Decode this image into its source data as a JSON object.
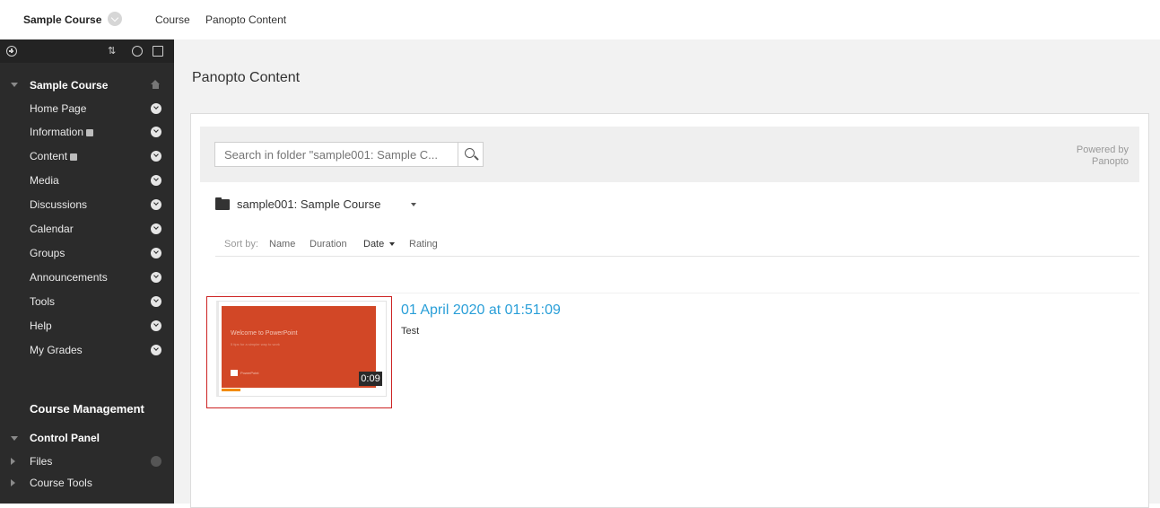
{
  "breadcrumb": {
    "course": "Sample Course",
    "item2": "Course",
    "item3": "Panopto Content"
  },
  "sidebar": {
    "tools": [
      "plus-icon",
      "sort-icon",
      "refresh-icon",
      "folder-icon"
    ],
    "course_section": "Sample Course",
    "items": [
      {
        "label": "Home Page"
      },
      {
        "label": "Information"
      },
      {
        "label": "Content"
      },
      {
        "label": "Media"
      },
      {
        "label": "Discussions"
      },
      {
        "label": "Calendar"
      },
      {
        "label": "Groups"
      },
      {
        "label": "Announcements"
      },
      {
        "label": "Tools"
      },
      {
        "label": "Help"
      },
      {
        "label": "My Grades"
      }
    ],
    "management_title": "Course Management",
    "control_panel": "Control Panel",
    "sub_items": [
      {
        "label": "Files"
      },
      {
        "label": "Course Tools"
      }
    ]
  },
  "main": {
    "title": "Panopto Content",
    "search_placeholder": "Search in folder \"sample001: Sample C...",
    "powered_line1": "Powered by",
    "powered_line2": "Panopto",
    "folder_name": "sample001: Sample Course",
    "sort": {
      "label": "Sort by:",
      "options": [
        "Name",
        "Duration",
        "Date",
        "Rating"
      ],
      "active": "Date"
    },
    "session": {
      "title": "01 April 2020 at 01:51:09",
      "description": "Test",
      "duration": "0:09",
      "progress": 0.12,
      "slide_title": "Welcome to PowerPoint",
      "slide_subtitle": "5 tips for a simpler way to work",
      "slide_brand": "PowerPoint"
    }
  },
  "colors": {
    "sidebar_bg": "#2b2b2b",
    "link_blue": "#2a9fd8",
    "slide_orange": "#d24726",
    "highlight_red": "#cc2222"
  }
}
